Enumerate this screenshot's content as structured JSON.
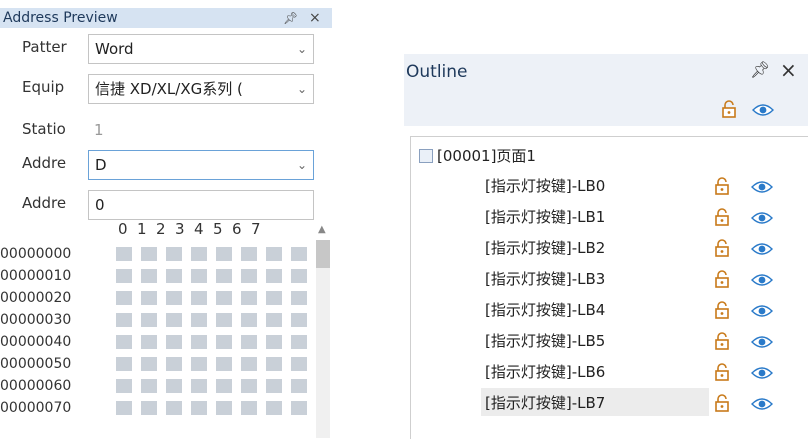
{
  "address_preview": {
    "title": "Address Preview",
    "pin_glyph": "ȣ",
    "close_glyph": "×",
    "fields": [
      {
        "label": "Patter",
        "value": "Word",
        "type": "select"
      },
      {
        "label": "Equip",
        "value": "信捷 XD/XL/XG系列 (",
        "type": "select"
      },
      {
        "label": "Statio",
        "value": "1",
        "type": "readonly"
      },
      {
        "label": "Addre",
        "value": "D",
        "type": "select-focused"
      },
      {
        "label": "Addre",
        "value": "0",
        "type": "input"
      }
    ],
    "column_headers": [
      "0",
      "1",
      "2",
      "3",
      "4",
      "5",
      "6",
      "7"
    ],
    "rows": [
      "00000000",
      "00000010",
      "00000020",
      "00000030",
      "00000040",
      "00000050",
      "00000060",
      "00000070"
    ],
    "cell_color": "#c9d0d8"
  },
  "outline": {
    "title": "Outline",
    "pin_glyph": "ȣ",
    "close_glyph": "×",
    "root_label": "[00001]页面1",
    "items": [
      "[指示灯按键]-LB0",
      "[指示灯按键]-LB1",
      "[指示灯按键]-LB2",
      "[指示灯按键]-LB3",
      "[指示灯按键]-LB4",
      "[指示灯按键]-LB5",
      "[指示灯按键]-LB6",
      "[指示灯按键]-LB7"
    ],
    "selected_index": 7,
    "accent_color": "#2a7ac9",
    "lock_color": "#c87a1a"
  }
}
